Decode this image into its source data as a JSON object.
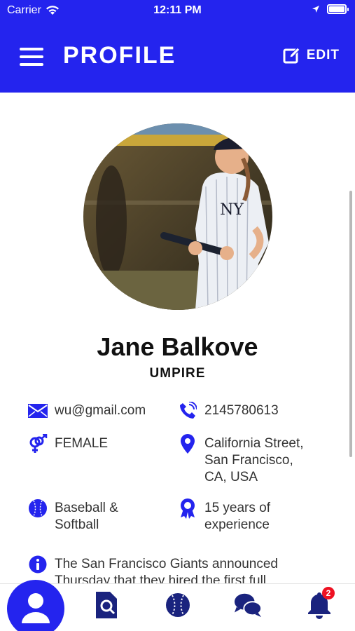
{
  "status_bar": {
    "carrier": "Carrier",
    "time": "12:11 PM"
  },
  "header": {
    "title": "PROFILE",
    "edit_label": "EDIT"
  },
  "profile": {
    "name": "Jane Balkove",
    "role": "UMPIRE",
    "email": "wu@gmail.com",
    "phone": "2145780613",
    "gender": "FEMALE",
    "address_lines": [
      "California Street,",
      "San Francisco,",
      "CA, USA"
    ],
    "sport_lines": [
      "Baseball &",
      "Softball"
    ],
    "experience_lines": [
      "15 years of",
      "experience"
    ],
    "bio_lines": [
      "The San Francisco Giants announced",
      "Thursday that they hired the first full"
    ]
  },
  "bottom_nav": {
    "items": [
      {
        "icon": "user-icon"
      },
      {
        "icon": "search-document-icon"
      },
      {
        "icon": "baseball-icon"
      },
      {
        "icon": "chat-icon"
      },
      {
        "icon": "bell-icon",
        "badge": "2"
      }
    ]
  },
  "colors": {
    "primary": "#2424ee",
    "badge": "#e11122"
  }
}
